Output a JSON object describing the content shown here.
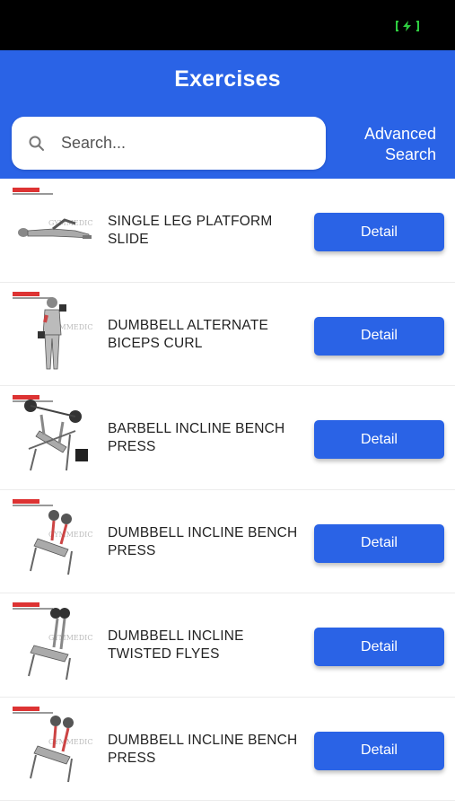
{
  "header": {
    "title": "Exercises",
    "advanced_search_label": "Advanced Search"
  },
  "search": {
    "placeholder": "Search...",
    "value": ""
  },
  "exercises": [
    {
      "name": "SINGLE LEG PLATFORM SLIDE",
      "button_label": "Detail"
    },
    {
      "name": "DUMBBELL ALTERNATE BICEPS CURL",
      "button_label": "Detail"
    },
    {
      "name": "BARBELL INCLINE BENCH PRESS",
      "button_label": "Detail"
    },
    {
      "name": "DUMBBELL INCLINE BENCH PRESS",
      "button_label": "Detail"
    },
    {
      "name": "DUMBBELL INCLINE TWISTED FLYES",
      "button_label": "Detail"
    },
    {
      "name": "DUMBBELL INCLINE BENCH PRESS",
      "button_label": "Detail"
    }
  ],
  "colors": {
    "primary": "#2a63e6",
    "status_bar": "#000000",
    "battery_icon": "#2ecc40"
  },
  "icons": [
    "battery-charging-icon",
    "search-icon"
  ]
}
